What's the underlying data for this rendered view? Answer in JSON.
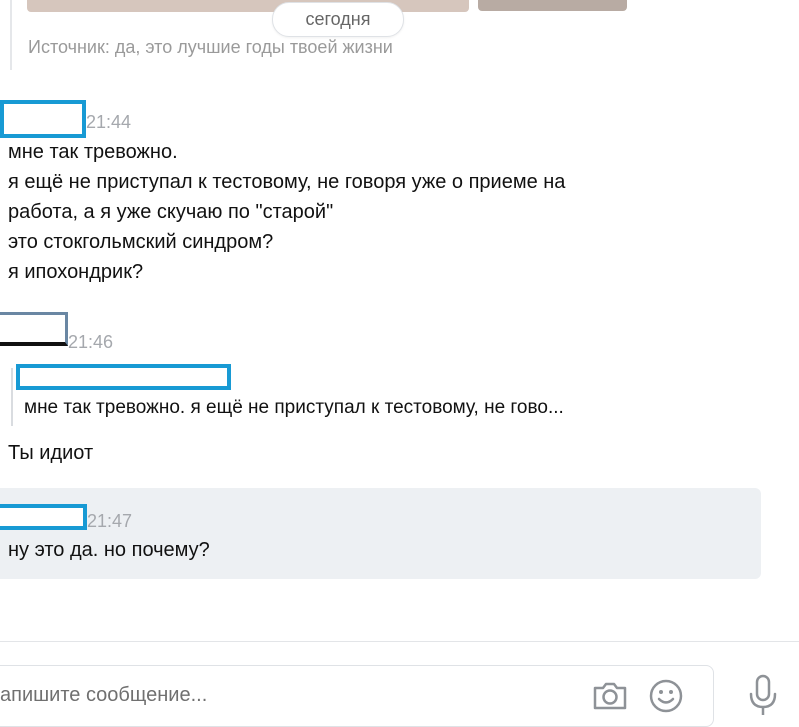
{
  "date_divider": "сегодня",
  "source_line": "Источник: да, это лучшие годы твоей жизни",
  "messages": [
    {
      "time": "21:44",
      "lines": [
        "мне так тревожно.",
        "я ещё не приступал к тестовому, не говоря уже о приеме на",
        "работа, а я уже скучаю по \"старой\"",
        "это стокгольмский синдром?",
        "я ипохондрик?"
      ]
    },
    {
      "time": "21:46",
      "reply_preview": "мне так тревожно. я ещё не приступал к тестовому, не гово...",
      "text": "Ты идиот"
    },
    {
      "time": "21:47",
      "text": "ну это да. но почему?"
    }
  ],
  "input": {
    "placeholder": "апишите сообщение..."
  },
  "icons": {
    "camera": "camera-icon",
    "emoji": "emoji-icon",
    "mic": "microphone-icon"
  },
  "colors": {
    "redaction_box": "#189ad4",
    "highlight_bg": "#edf0f3",
    "time_gray": "#a5a8ad"
  }
}
